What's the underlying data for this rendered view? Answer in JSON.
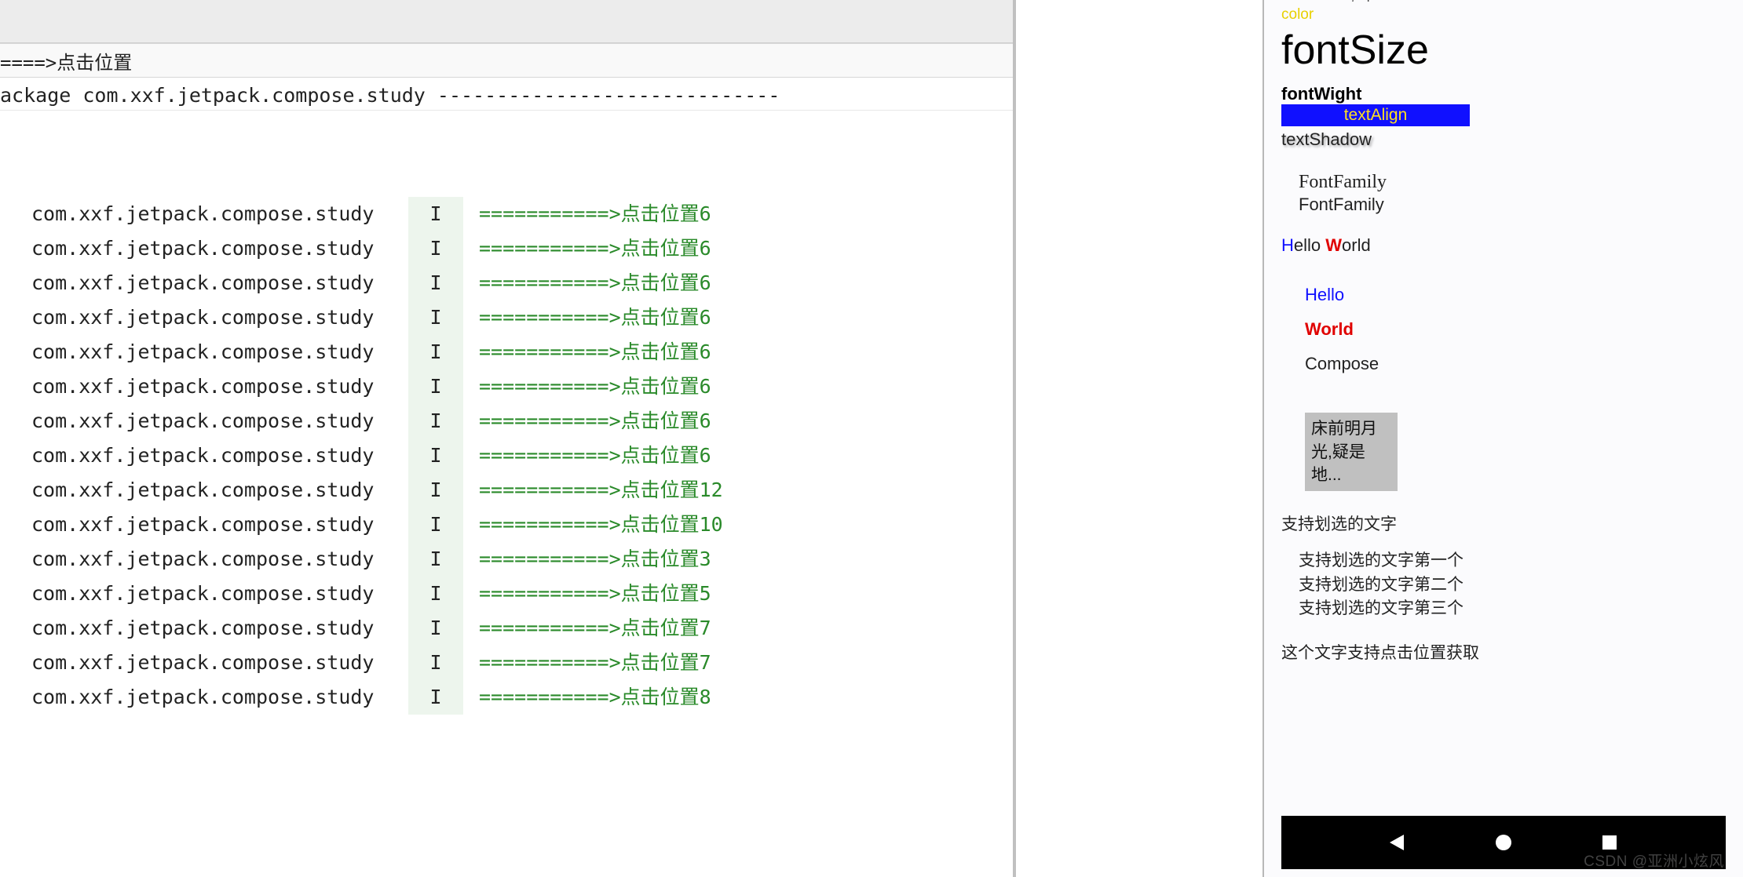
{
  "filter": {
    "text": "====>点击位置"
  },
  "header": {
    "text": "ackage com.xxf.jetpack.compose.study -----------------------------"
  },
  "log": {
    "tag": "com.xxf.jetpack.compose.study",
    "level": "I",
    "prefix": "===========>点击位置",
    "entries": [
      6,
      6,
      6,
      6,
      6,
      6,
      6,
      6,
      12,
      10,
      3,
      5,
      7,
      7,
      8
    ]
  },
  "phone": {
    "top_cut": "compose_study",
    "color_label": "color",
    "fontsize_label": "fontSize",
    "fontweight_label": "fontWight",
    "textalign_label": "textAlign",
    "textshadow_label": "textShadow",
    "fontfamily1": "FontFamily",
    "fontfamily2": "FontFamily",
    "hello_world": {
      "h": "H",
      "ello": "ello ",
      "w": "W",
      "orld": "orld"
    },
    "vlist": {
      "hello": "Hello",
      "world": "World",
      "compose": "Compose"
    },
    "poem_line1": "床前明月",
    "poem_line2": "光,疑是地...",
    "selectable_header": "支持划选的文字",
    "selectable_items": [
      "支持划选的文字第一个",
      "支持划选的文字第二个",
      "支持划选的文字第三个"
    ],
    "click_pos_text": "这个文字支持点击位置获取"
  },
  "watermark": "CSDN @亚洲小炫风"
}
